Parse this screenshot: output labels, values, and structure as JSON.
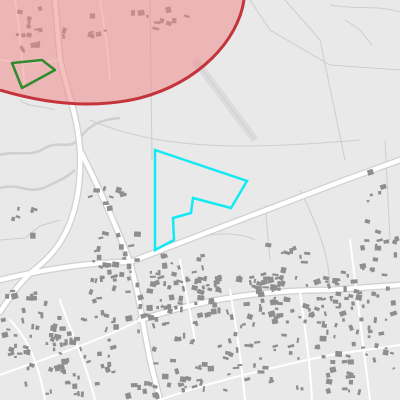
{
  "map": {
    "style": "greyscale street basemap",
    "colors": {
      "background": "#e9e9e9",
      "road": "#ffffff",
      "road_casing": "#d2d2d2",
      "building": "#8e8e8e",
      "water": "#d6d6d6",
      "track": "#c8c8c8"
    },
    "overlays": {
      "restricted_zone": {
        "fill": "#ef8c8c",
        "fill_opacity": 0.55,
        "stroke": "#c4343b",
        "icon": "circle-area"
      },
      "small_polygon": {
        "stroke": "#2e8b2e",
        "icon": "polygon-outline"
      },
      "selected_area": {
        "stroke": "#13e9f2",
        "icon": "polygon-outline"
      }
    }
  }
}
